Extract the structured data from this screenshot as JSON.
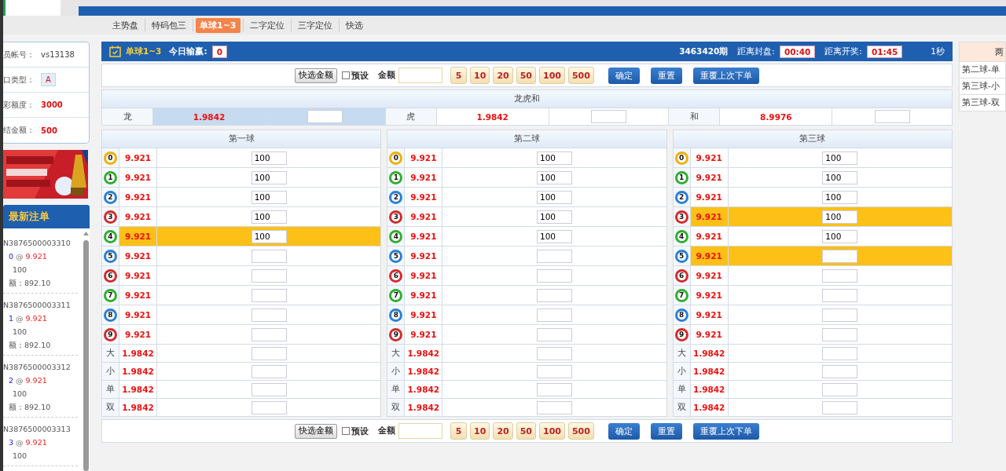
{
  "subnav": [
    {
      "label": "主势盘",
      "selected": false
    },
    {
      "label": "特码包三",
      "selected": false
    },
    {
      "label": "单球1~3",
      "selected": true
    },
    {
      "label": "二字定位",
      "selected": false
    },
    {
      "label": "三字定位",
      "selected": false
    },
    {
      "label": "快选",
      "selected": false
    }
  ],
  "account": [
    {
      "label": "员帐号：",
      "value": "vs13138",
      "kind": "plain"
    },
    {
      "label": "口类型：",
      "value": "A",
      "kind": "badge"
    },
    {
      "label": "彩额度：",
      "value": "3000",
      "kind": "red"
    },
    {
      "label": "结金额：",
      "value": "500",
      "kind": "red"
    }
  ],
  "recent_bets": {
    "title": "最新注单",
    "items": [
      {
        "id": "N3876500003310",
        "pick": "0",
        "sep": "@",
        "odds": "9.921",
        "amount": "100",
        "payout": "额：892.10"
      },
      {
        "id": "N3876500003311",
        "pick": "1",
        "sep": "@",
        "odds": "9.921",
        "amount": "100",
        "payout": "额：892.10"
      },
      {
        "id": "N3876500003312",
        "pick": "2",
        "sep": "@",
        "odds": "9.921",
        "amount": "100",
        "payout": "额：892.10"
      },
      {
        "id": "N3876500003313",
        "pick": "3",
        "sep": "@",
        "odds": "9.921",
        "amount": "100"
      }
    ]
  },
  "header": {
    "game": "单球1~3",
    "today_label": "今日输赢:",
    "today_value": "0",
    "period": "3463420期",
    "close_label": "距离封盘:",
    "close_time": "00:40",
    "draw_label": "距离开奖:",
    "draw_time": "01:45",
    "refresh": "1秒"
  },
  "toolbars": [
    {
      "quick": "快选金额",
      "preset": {
        "label": "预设",
        "checked": false
      },
      "amount_label": "金额",
      "chips": [
        "5",
        "10",
        "20",
        "50",
        "100",
        "500"
      ],
      "confirm": "确定",
      "reset": "重置",
      "repeat": "重覆上次下单"
    },
    {
      "quick": "快选金额",
      "preset": {
        "label": "预设",
        "checked": false
      },
      "amount_label": "金额",
      "chips": [
        "5",
        "10",
        "20",
        "50",
        "100",
        "500"
      ],
      "confirm": "确定",
      "reset": "重置",
      "repeat": "重覆上次下单"
    }
  ],
  "dragon_tiger": {
    "title": "龙虎和",
    "items": [
      {
        "label": "龙",
        "odds": "1.9842",
        "selected": true
      },
      {
        "label": "虎",
        "odds": "1.9842",
        "selected": false
      },
      {
        "label": "和",
        "odds": "8.9976",
        "selected": false
      }
    ]
  },
  "balls": [
    {
      "title": "第一球",
      "numbers": [
        {
          "ball": "0",
          "color": "#eeb000",
          "odds": "9.921",
          "amount": "100",
          "selected": false
        },
        {
          "ball": "1",
          "color": "#2fae2f",
          "odds": "9.921",
          "amount": "100",
          "selected": false
        },
        {
          "ball": "2",
          "color": "#2a7fd4",
          "odds": "9.921",
          "amount": "100",
          "selected": false
        },
        {
          "ball": "3",
          "color": "#d42a2a",
          "odds": "9.921",
          "amount": "100",
          "selected": false
        },
        {
          "ball": "4",
          "color": "#2fae2f",
          "odds": "9.921",
          "amount": "100",
          "selected": true
        },
        {
          "ball": "5",
          "color": "#2a7fd4",
          "odds": "9.921",
          "selected": false
        },
        {
          "ball": "6",
          "color": "#d42a2a",
          "odds": "9.921",
          "selected": false
        },
        {
          "ball": "7",
          "color": "#2fae2f",
          "odds": "9.921",
          "selected": false
        },
        {
          "ball": "8",
          "color": "#2a7fd4",
          "odds": "9.921",
          "selected": false
        },
        {
          "ball": "9",
          "color": "#d42a2a",
          "odds": "9.921",
          "selected": false
        }
      ],
      "sides": [
        {
          "label": "大",
          "odds": "1.9842"
        },
        {
          "label": "小",
          "odds": "1.9842"
        },
        {
          "label": "单",
          "odds": "1.9842"
        },
        {
          "label": "双",
          "odds": "1.9842"
        }
      ]
    },
    {
      "title": "第二球",
      "numbers": [
        {
          "ball": "0",
          "color": "#eeb000",
          "odds": "9.921",
          "amount": "100",
          "selected": false
        },
        {
          "ball": "1",
          "color": "#2fae2f",
          "odds": "9.921",
          "amount": "100",
          "selected": false
        },
        {
          "ball": "2",
          "color": "#2a7fd4",
          "odds": "9.921",
          "amount": "100",
          "selected": false
        },
        {
          "ball": "3",
          "color": "#d42a2a",
          "odds": "9.921",
          "amount": "100",
          "selected": false
        },
        {
          "ball": "4",
          "color": "#2fae2f",
          "odds": "9.921",
          "amount": "100",
          "selected": false
        },
        {
          "ball": "5",
          "color": "#2a7fd4",
          "odds": "9.921",
          "selected": false
        },
        {
          "ball": "6",
          "color": "#d42a2a",
          "odds": "9.921",
          "selected": false
        },
        {
          "ball": "7",
          "color": "#2fae2f",
          "odds": "9.921",
          "selected": false
        },
        {
          "ball": "8",
          "color": "#2a7fd4",
          "odds": "9.921",
          "selected": false
        },
        {
          "ball": "9",
          "color": "#d42a2a",
          "odds": "9.921",
          "selected": false
        }
      ],
      "sides": [
        {
          "label": "大",
          "odds": "1.9842"
        },
        {
          "label": "小",
          "odds": "1.9842"
        },
        {
          "label": "单",
          "odds": "1.9842"
        },
        {
          "label": "双",
          "odds": "1.9842"
        }
      ]
    },
    {
      "title": "第三球",
      "numbers": [
        {
          "ball": "0",
          "color": "#eeb000",
          "odds": "9.921",
          "amount": "100",
          "selected": false
        },
        {
          "ball": "1",
          "color": "#2fae2f",
          "odds": "9.921",
          "amount": "100",
          "selected": false
        },
        {
          "ball": "2",
          "color": "#2a7fd4",
          "odds": "9.921",
          "amount": "100",
          "selected": false
        },
        {
          "ball": "3",
          "color": "#d42a2a",
          "odds": "9.921",
          "amount": "100",
          "selected": true
        },
        {
          "ball": "4",
          "color": "#2fae2f",
          "odds": "9.921",
          "amount": "100",
          "selected": false
        },
        {
          "ball": "5",
          "color": "#2a7fd4",
          "odds": "9.921",
          "selected": true
        },
        {
          "ball": "6",
          "color": "#d42a2a",
          "odds": "9.921",
          "selected": false
        },
        {
          "ball": "7",
          "color": "#2fae2f",
          "odds": "9.921",
          "selected": false
        },
        {
          "ball": "8",
          "color": "#2a7fd4",
          "odds": "9.921",
          "selected": false
        },
        {
          "ball": "9",
          "color": "#d42a2a",
          "odds": "9.921",
          "selected": false
        }
      ],
      "sides": [
        {
          "label": "大",
          "odds": "1.9842"
        },
        {
          "label": "小",
          "odds": "1.9842"
        },
        {
          "label": "单",
          "odds": "1.9842"
        },
        {
          "label": "双",
          "odds": "1.9842"
        }
      ]
    }
  ],
  "side_panel": {
    "title": "两",
    "items": [
      "第二球-单",
      "第三球-小",
      "第三球-双"
    ]
  }
}
